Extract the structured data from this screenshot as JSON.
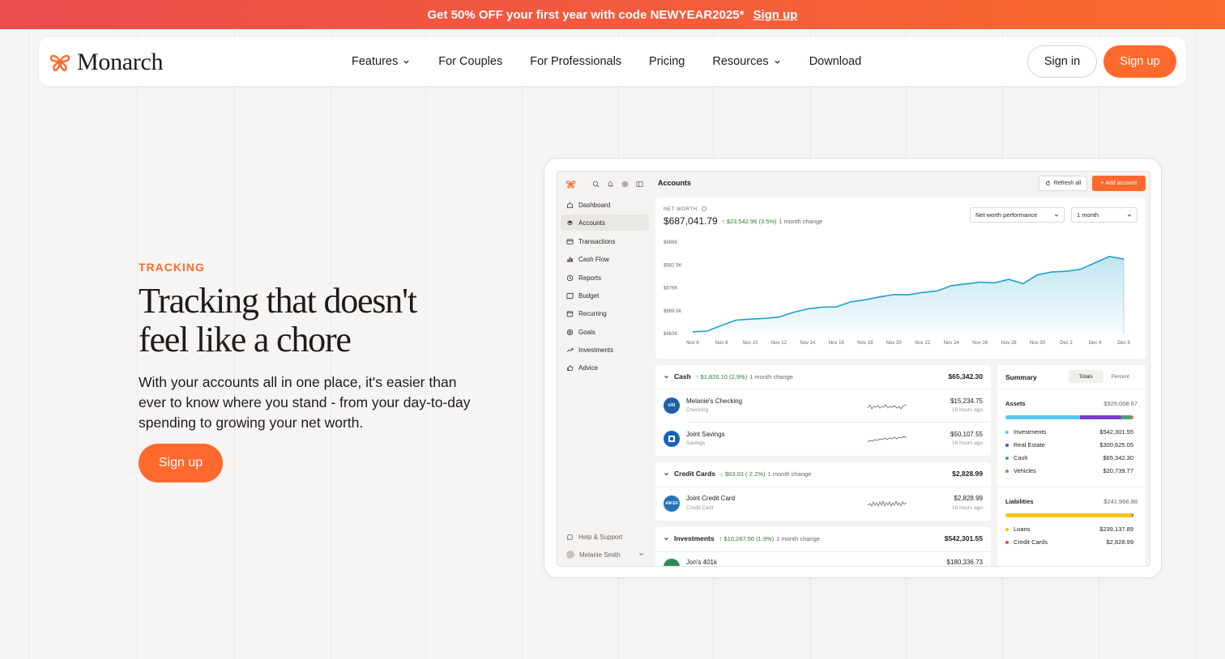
{
  "colors": {
    "brand": "#ff692d",
    "positive": "#2e7d32",
    "chart_line": "#1e9fc9"
  },
  "promo": {
    "text": "Get 50% OFF your first year with code NEWYEAR2025*",
    "link": "Sign up"
  },
  "nav": {
    "logo_text": "Monarch",
    "links": [
      {
        "label": "Features",
        "dropdown": true
      },
      {
        "label": "For Couples",
        "dropdown": false
      },
      {
        "label": "For Professionals",
        "dropdown": false
      },
      {
        "label": "Pricing",
        "dropdown": false
      },
      {
        "label": "Resources",
        "dropdown": true
      },
      {
        "label": "Download",
        "dropdown": false
      }
    ],
    "sign_in": "Sign in",
    "sign_up": "Sign up"
  },
  "hero": {
    "eyebrow": "TRACKING",
    "headline_line1": "Tracking that doesn't",
    "headline_line2": "feel like a chore",
    "subtext": "With your accounts all in one place, it's easier than ever to know where you stand - from your day-to-day spending to growing your net worth.",
    "cta": "Sign up"
  },
  "app": {
    "page_title": "Accounts",
    "refresh_all": "Refresh all",
    "add_account": "+ Add account",
    "sidebar": {
      "items": [
        {
          "label": "Dashboard",
          "icon": "home-icon"
        },
        {
          "label": "Accounts",
          "icon": "layers-icon",
          "active": true
        },
        {
          "label": "Transactions",
          "icon": "card-icon"
        },
        {
          "label": "Cash Flow",
          "icon": "bar-chart-icon"
        },
        {
          "label": "Reports",
          "icon": "clock-icon"
        },
        {
          "label": "Budget",
          "icon": "map-icon"
        },
        {
          "label": "Recurring",
          "icon": "calendar-icon"
        },
        {
          "label": "Goals",
          "icon": "target-icon"
        },
        {
          "label": "Investments",
          "icon": "trend-icon"
        },
        {
          "label": "Advice",
          "icon": "thumb-icon"
        }
      ],
      "help": "Help & Support",
      "user": "Melanie Smith"
    },
    "net_worth": {
      "label": "NET WORTH",
      "value": "$687,041.79",
      "change": "↑ $23,542.96 (3.5%)",
      "change_label": "1 month change",
      "dropdown_metric": "Net worth performance",
      "dropdown_range": "1 month"
    },
    "sections": {
      "cash": {
        "title": "Cash",
        "change": "↑ $1,826.10 (2.9%)",
        "change_label": "1 month change",
        "total": "$65,342.30",
        "accounts": [
          {
            "name": "Melanie's Checking",
            "type": "Checking",
            "balance": "$15,234.75",
            "updated": "16 hours ago",
            "logo": "citi"
          },
          {
            "name": "Joint Savings",
            "type": "Savings",
            "balance": "$50,107.55",
            "updated": "16 hours ago",
            "logo": "chase"
          }
        ]
      },
      "credit": {
        "title": "Credit Cards",
        "change": "↓ $63.03 (-2.2%)",
        "change_label": "1 month change",
        "total": "$2,828.99",
        "accounts": [
          {
            "name": "Joint Credit Card",
            "type": "Credit Card",
            "balance": "$2,828.99",
            "updated": "16 hours ago",
            "logo": "AM EX"
          }
        ]
      },
      "investments": {
        "title": "Investments",
        "change": "↑ $10,287.56 (1.9%)",
        "change_label": "1 month change",
        "total": "$542,301.55",
        "accounts": [
          {
            "name": "Jon's 401k",
            "balance": "$180,336.73"
          }
        ]
      }
    },
    "summary": {
      "title": "Summary",
      "toggle": [
        "Totals",
        "Percent"
      ],
      "assets": {
        "label": "Assets",
        "total": "$929,008.67",
        "rows": [
          {
            "label": "Investments",
            "value": "$542,301.55",
            "color": "#56c8ef",
            "fraction": 0.584
          },
          {
            "label": "Real Estate",
            "value": "$300,625.05",
            "color": "#7a3fc7",
            "fraction": 0.324
          },
          {
            "label": "Cash",
            "value": "$65,342.30",
            "color": "#3fa66a",
            "fraction": 0.07
          },
          {
            "label": "Vehicles",
            "value": "$20,739.77",
            "color": "#f06b2e",
            "fraction": 0.022
          }
        ]
      },
      "liabilities": {
        "label": "Liabilities",
        "total": "$241,966.88",
        "rows": [
          {
            "label": "Loans",
            "value": "$239,137.89",
            "color": "#f5c518",
            "fraction": 0.988
          },
          {
            "label": "Credit Cards",
            "value": "$2,828.99",
            "color": "#e5484d",
            "fraction": 0.012
          }
        ]
      }
    }
  },
  "chart_data": {
    "type": "area",
    "title": "",
    "xlabel": "",
    "ylabel": "",
    "y_ticks": [
      "$689K",
      "$682.5K",
      "$676K",
      "$669.5K",
      "$663K"
    ],
    "ylim": [
      663000,
      689000
    ],
    "x_ticks": [
      "Nov 6",
      "Nov 8",
      "Nov 10",
      "Nov 12",
      "Nov 14",
      "Nov 16",
      "Nov 18",
      "Nov 20",
      "Nov 22",
      "Nov 24",
      "Nov 26",
      "Nov 28",
      "Nov 30",
      "Dec 2",
      "Dec 4",
      "Dec 6"
    ],
    "x": [
      "Nov 6",
      "Nov 7",
      "Nov 8",
      "Nov 9",
      "Nov 10",
      "Nov 11",
      "Nov 12",
      "Nov 13",
      "Nov 14",
      "Nov 15",
      "Nov 16",
      "Nov 17",
      "Nov 18",
      "Nov 19",
      "Nov 20",
      "Nov 21",
      "Nov 22",
      "Nov 23",
      "Nov 24",
      "Nov 25",
      "Nov 26",
      "Nov 27",
      "Nov 28",
      "Nov 29",
      "Nov 30",
      "Dec 1",
      "Dec 2",
      "Dec 3",
      "Dec 4",
      "Dec 5",
      "Dec 6"
    ],
    "values": [
      663500,
      663700,
      665300,
      666800,
      667100,
      667300,
      667700,
      669000,
      670000,
      670500,
      670600,
      672000,
      672600,
      673400,
      674100,
      674000,
      674700,
      675100,
      676600,
      677100,
      677600,
      677400,
      678400,
      677200,
      679700,
      680500,
      680700,
      681300,
      683100,
      684900,
      684200
    ],
    "series": [
      {
        "values_ref": "values"
      }
    ],
    "grid": false,
    "legend": "none"
  }
}
